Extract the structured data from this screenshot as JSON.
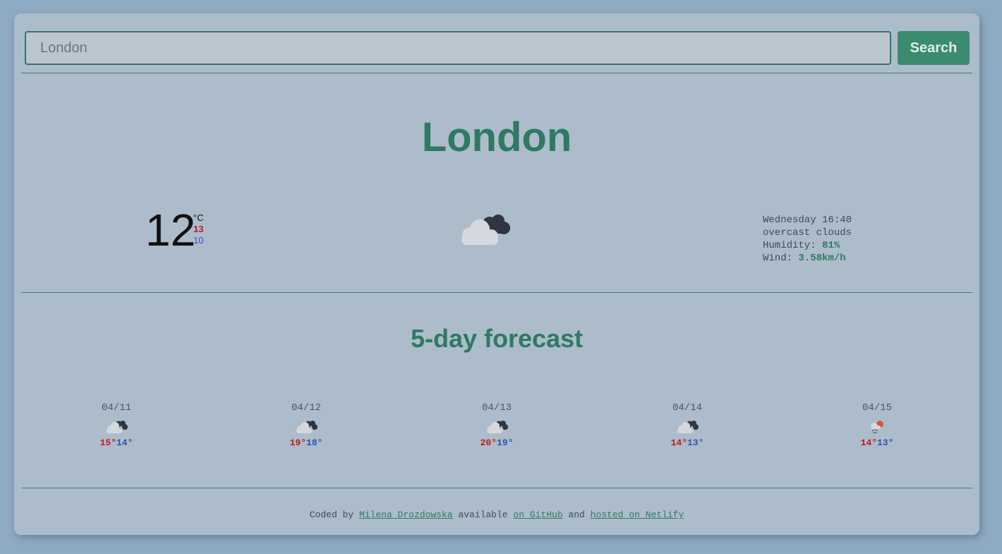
{
  "search": {
    "placeholder": "London",
    "button_label": "Search"
  },
  "current": {
    "city": "London",
    "temp": "12",
    "unit": "°C",
    "high": "13",
    "low": "10",
    "icon": "overcast-clouds-icon",
    "day_time": "Wednesday 16:40",
    "description": "overcast clouds",
    "humidity_label": "Humidity: ",
    "humidity": "81%",
    "wind_label": "Wind: ",
    "wind": "3.58km/h"
  },
  "forecast": {
    "title": "5-day forecast",
    "days": [
      {
        "date": "04/11",
        "icon": "overcast-clouds-icon",
        "high": "15°",
        "low": "14°"
      },
      {
        "date": "04/12",
        "icon": "overcast-clouds-icon",
        "high": "19°",
        "low": "18°"
      },
      {
        "date": "04/13",
        "icon": "overcast-clouds-icon",
        "high": "20°",
        "low": "19°"
      },
      {
        "date": "04/14",
        "icon": "overcast-clouds-icon",
        "high": "14°",
        "low": "13°"
      },
      {
        "date": "04/15",
        "icon": "snow-sun-icon",
        "high": "14°",
        "low": "13°"
      }
    ]
  },
  "footer": {
    "prefix": "Coded by ",
    "author": "Milena Drozdowska",
    "middle": " available ",
    "github": "on GitHub",
    "and": " and ",
    "netlify": "hosted on Netlify"
  },
  "colors": {
    "background": "#8eabc3",
    "card": "#adbccb",
    "accent": "#2e7a62",
    "high_temp": "#c4181e",
    "low_temp": "#2f52b2"
  }
}
